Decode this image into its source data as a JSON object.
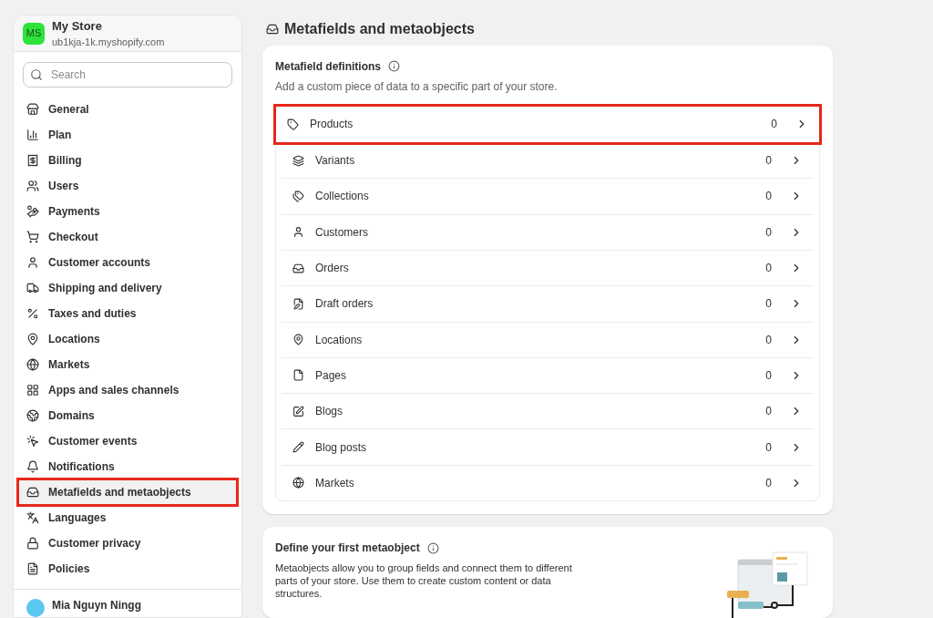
{
  "store": {
    "initials": "MS",
    "name": "My Store",
    "domain": "ub1kja-1k.myshopify.com"
  },
  "search": {
    "placeholder": "Search"
  },
  "sidebar": {
    "items": [
      {
        "label": "General",
        "selected": false,
        "highlighted": false
      },
      {
        "label": "Plan",
        "selected": false,
        "highlighted": false
      },
      {
        "label": "Billing",
        "selected": false,
        "highlighted": false
      },
      {
        "label": "Users",
        "selected": false,
        "highlighted": false
      },
      {
        "label": "Payments",
        "selected": false,
        "highlighted": false
      },
      {
        "label": "Checkout",
        "selected": false,
        "highlighted": false
      },
      {
        "label": "Customer accounts",
        "selected": false,
        "highlighted": false
      },
      {
        "label": "Shipping and delivery",
        "selected": false,
        "highlighted": false
      },
      {
        "label": "Taxes and duties",
        "selected": false,
        "highlighted": false
      },
      {
        "label": "Locations",
        "selected": false,
        "highlighted": false
      },
      {
        "label": "Markets",
        "selected": false,
        "highlighted": false
      },
      {
        "label": "Apps and sales channels",
        "selected": false,
        "highlighted": false
      },
      {
        "label": "Domains",
        "selected": false,
        "highlighted": false
      },
      {
        "label": "Customer events",
        "selected": false,
        "highlighted": false
      },
      {
        "label": "Notifications",
        "selected": false,
        "highlighted": false
      },
      {
        "label": "Metafields and metaobjects",
        "selected": true,
        "highlighted": true
      },
      {
        "label": "Languages",
        "selected": false,
        "highlighted": false
      },
      {
        "label": "Customer privacy",
        "selected": false,
        "highlighted": false
      },
      {
        "label": "Policies",
        "selected": false,
        "highlighted": false
      }
    ],
    "user": {
      "name": "Mia Nguyn Ningg"
    }
  },
  "page": {
    "title": "Metafields and metaobjects"
  },
  "definitions": {
    "title": "Metafield definitions",
    "description": "Add a custom piece of data to a specific part of your store.",
    "rows": [
      {
        "label": "Products",
        "count": "0",
        "highlighted": true
      },
      {
        "label": "Variants",
        "count": "0",
        "highlighted": false
      },
      {
        "label": "Collections",
        "count": "0",
        "highlighted": false
      },
      {
        "label": "Customers",
        "count": "0",
        "highlighted": false
      },
      {
        "label": "Orders",
        "count": "0",
        "highlighted": false
      },
      {
        "label": "Draft orders",
        "count": "0",
        "highlighted": false
      },
      {
        "label": "Locations",
        "count": "0",
        "highlighted": false
      },
      {
        "label": "Pages",
        "count": "0",
        "highlighted": false
      },
      {
        "label": "Blogs",
        "count": "0",
        "highlighted": false
      },
      {
        "label": "Blog posts",
        "count": "0",
        "highlighted": false
      },
      {
        "label": "Markets",
        "count": "0",
        "highlighted": false
      }
    ]
  },
  "metaobject": {
    "title": "Define your first metaobject",
    "description": "Metaobjects allow you to group fields and connect them to different parts of your store. Use them to create custom content or data structures."
  }
}
